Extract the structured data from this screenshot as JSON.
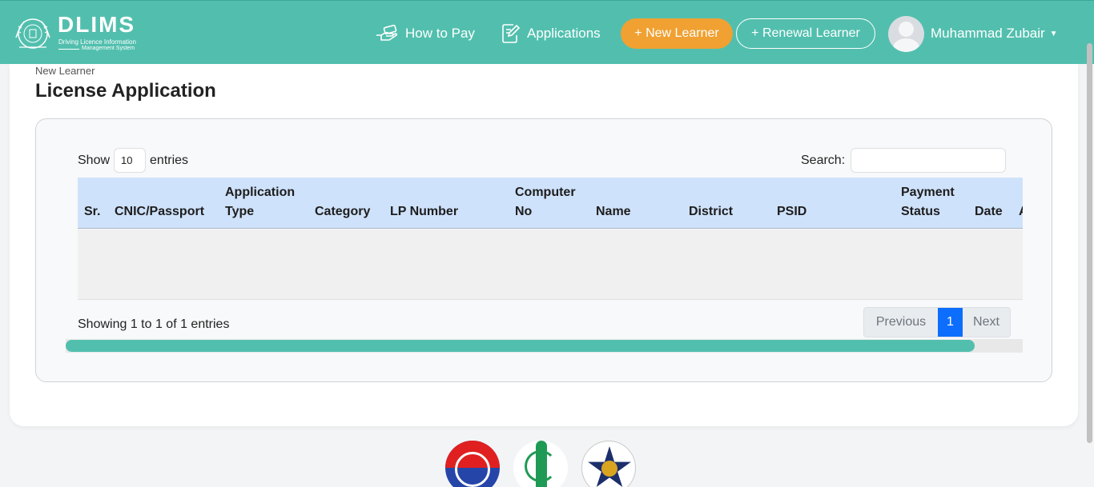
{
  "navbar": {
    "brand": {
      "title": "DLIMS",
      "subtitle_line1": "Driving Licence Information",
      "subtitle_line2": "Management System"
    },
    "links": {
      "how_to_pay": "How to Pay",
      "applications": "Applications"
    },
    "buttons": {
      "new_learner": "+ New Learner",
      "renewal_learner": "+ Renewal Learner"
    },
    "user": {
      "name": "Muhammad Zubair"
    },
    "icons": {
      "how_to_pay": "hand-money-icon",
      "applications": "document-edit-icon",
      "user_menu": "caret-down-icon"
    },
    "colors": {
      "navbar_bg": "#52bfae",
      "new_learner_bg": "#f0a132"
    }
  },
  "page": {
    "breadcrumb": "New Learner",
    "title": "License Application"
  },
  "table_controls": {
    "show_label": "Show",
    "entries_value": "10",
    "entries_label": "entries",
    "search_label": "Search:",
    "search_value": ""
  },
  "table": {
    "columns": [
      {
        "line1": "",
        "line2": "Sr."
      },
      {
        "line1": "",
        "line2": "CNIC/Passport"
      },
      {
        "line1": "Application",
        "line2": "Type"
      },
      {
        "line1": "",
        "line2": "Category"
      },
      {
        "line1": "",
        "line2": "LP Number"
      },
      {
        "line1": "Computer",
        "line2": "No"
      },
      {
        "line1": "",
        "line2": "Name"
      },
      {
        "line1": "",
        "line2": "District"
      },
      {
        "line1": "",
        "line2": "PSID"
      },
      {
        "line1": "Payment",
        "line2": "Status"
      },
      {
        "line1": "",
        "line2": "Date"
      },
      {
        "line1": "",
        "line2": "A"
      }
    ],
    "rows": []
  },
  "pagination": {
    "info": "Showing 1 to 1 of 1 entries",
    "previous": "Previous",
    "current_page": "1",
    "next": "Next",
    "horizontal_scroll_fraction": 0.95
  }
}
